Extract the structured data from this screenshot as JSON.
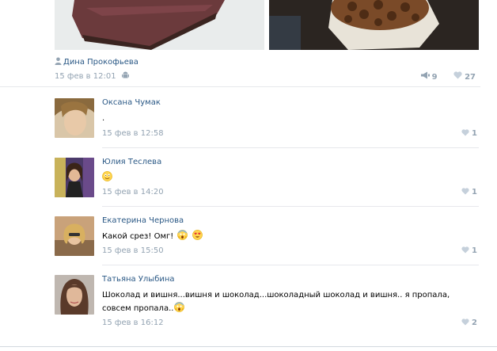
{
  "post": {
    "author": "Дина Прокофьева",
    "date": "15 фев в 12:01",
    "reposts": "9",
    "likes": "27"
  },
  "comments": [
    {
      "name": "Оксана Чумак",
      "text": ".",
      "date": "15 фев в 12:58",
      "likes": "1"
    },
    {
      "name": "Юлия Теслева",
      "text": "",
      "date": "15 фев в 14:20",
      "likes": "1"
    },
    {
      "name": "Екатерина Чернова",
      "text": "Какой срез! Омг!",
      "date": "15 фев в 15:50",
      "likes": "1"
    },
    {
      "name": "Татьяна Улыбина",
      "text": "Шоколад и вишня...вишня и шоколад...шоколадный шоколад и вишня.. я пропала, совсем пропала..",
      "date": "15 фев в 16:12",
      "likes": "2"
    }
  ],
  "colors": {
    "link": "#2a5885",
    "muted": "#93a3b2",
    "divider": "#e7e8ec"
  },
  "icons": [
    "person-icon",
    "android-icon",
    "megaphone-icon",
    "heart-icon",
    "smile-emoji",
    "scream-emoji",
    "heart-eyes-emoji"
  ]
}
